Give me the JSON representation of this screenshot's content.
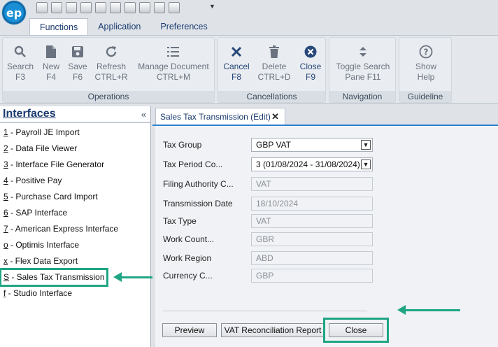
{
  "app": {
    "logo_text": "ep"
  },
  "ribbon_tabs": [
    "Functions",
    "Application",
    "Preferences"
  ],
  "ribbon": {
    "operations": {
      "label": "Operations",
      "buttons": [
        {
          "label": "Search",
          "shortcut": "F3",
          "icon": "search-icon"
        },
        {
          "label": "New",
          "shortcut": "F4",
          "icon": "new-document-icon"
        },
        {
          "label": "Save",
          "shortcut": "F6",
          "icon": "save-icon"
        },
        {
          "label": "Refresh",
          "shortcut": "CTRL+R",
          "icon": "refresh-icon"
        },
        {
          "label": "Manage Document",
          "shortcut": "CTRL+M",
          "icon": "manage-document-icon"
        }
      ]
    },
    "cancellations": {
      "label": "Cancellations",
      "buttons": [
        {
          "label": "Cancel",
          "shortcut": "F8",
          "icon": "cancel-x-icon"
        },
        {
          "label": "Delete",
          "shortcut": "CTRL+D",
          "icon": "trash-icon"
        },
        {
          "label": "Close",
          "shortcut": "F9",
          "icon": "close-circle-icon"
        }
      ]
    },
    "navigation": {
      "label": "Navigation",
      "buttons": [
        {
          "label": "Toggle Search",
          "shortcut": "Pane F11",
          "icon": "toggle-arrows-icon"
        }
      ]
    },
    "guideline": {
      "label": "Guideline",
      "buttons": [
        {
          "label": "Show",
          "shortcut": "Help",
          "icon": "help-icon"
        }
      ]
    }
  },
  "interfaces": {
    "title": "Interfaces",
    "collapse": "«",
    "items": [
      {
        "key": "1",
        "label": " - Payroll JE Import"
      },
      {
        "key": "2",
        "label": " - Data File Viewer"
      },
      {
        "key": "3",
        "label": " - Interface File Generator"
      },
      {
        "key": "4",
        "label": " - Positive Pay"
      },
      {
        "key": "5",
        "label": " - Purchase Card Import"
      },
      {
        "key": "6",
        "label": " - SAP Interface"
      },
      {
        "key": "7",
        "label": " - American Express Interface"
      },
      {
        "key": "o",
        "label": " - Optimis Interface"
      },
      {
        "key": "x",
        "label": " - Flex Data Export"
      },
      {
        "key": "S",
        "label": " - Sales Tax Transmission"
      },
      {
        "key": "f",
        "label": " - Studio Interface"
      }
    ]
  },
  "document_tab": {
    "title": "Sales Tax Transmission (Edit)",
    "close": "✕"
  },
  "form": {
    "fields": [
      {
        "label": "Tax Group",
        "value": "GBP VAT",
        "type": "select"
      },
      {
        "label": "Tax Period Co...",
        "value": "3 (01/08/2024 - 31/08/2024)",
        "type": "select"
      },
      {
        "label": "Filing Authority C...",
        "value": "VAT",
        "type": "disabled"
      },
      {
        "label": "Transmission Date",
        "value": "18/10/2024",
        "type": "disabled"
      },
      {
        "label": "Tax Type",
        "value": "VAT",
        "type": "disabled"
      },
      {
        "label": "Work Count...",
        "value": "GBR",
        "type": "disabled"
      },
      {
        "label": "Work Region",
        "value": "ABD",
        "type": "disabled"
      },
      {
        "label": "Currency C...",
        "value": "GBP",
        "type": "disabled"
      }
    ],
    "buttons": {
      "preview": "Preview",
      "vat_report": "VAT Reconciliation Report",
      "close": "Close"
    }
  },
  "colors": {
    "highlight": "#1fa584",
    "accent_blue": "#27487a"
  }
}
